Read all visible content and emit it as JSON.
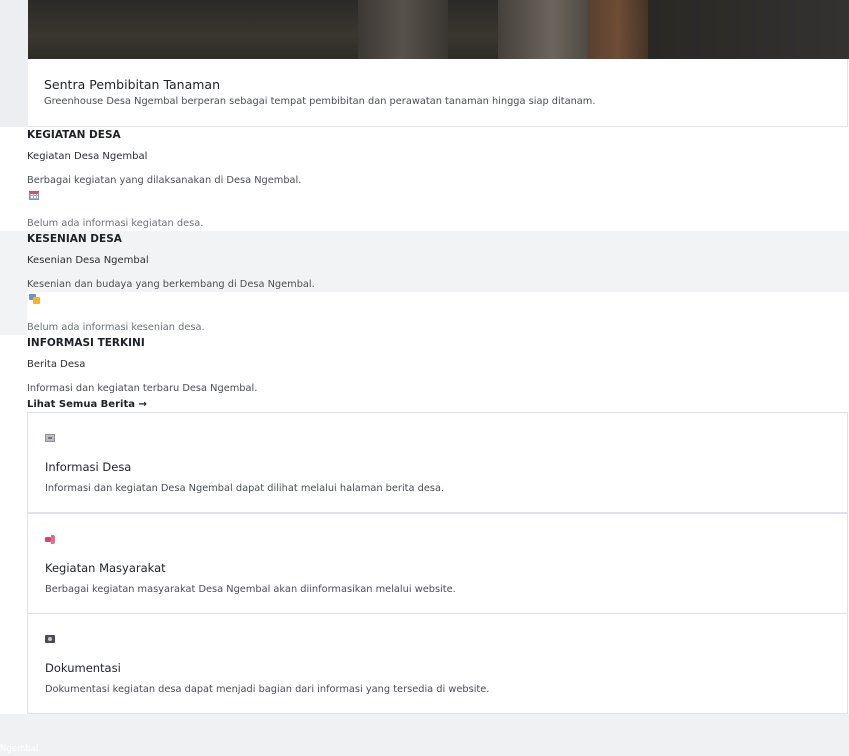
{
  "hero": {
    "title": "Sentra Pembibitan Tanaman",
    "description": "Greenhouse Desa Ngembal berperan sebagai tempat pembibitan dan perawatan tanaman hingga siap ditanam."
  },
  "kegiatan": {
    "label": "KEGIATAN DESA",
    "title": "Kegiatan Desa Ngembal",
    "subtitle": "Berbagai kegiatan yang dilaksanakan di Desa Ngembal.",
    "icon": "calendar-icon",
    "empty_text": "Belum ada informasi kegiatan desa."
  },
  "kesenian": {
    "label": "KESENIAN DESA",
    "title": "Kesenian Desa Ngembal",
    "subtitle": "Kesenian dan budaya yang berkembang di Desa Ngembal.",
    "icon": "art-icon",
    "empty_text": "Belum ada informasi kesenian desa."
  },
  "informasi": {
    "label": "INFORMASI TERKINI",
    "title": "Berita Desa",
    "subtitle": "Informasi dan kegiatan terbaru Desa Ngembal.",
    "link_all": "Lihat Semua Berita →",
    "cards": [
      {
        "icon": "newspaper-icon",
        "title": "Informasi Desa",
        "description": "Informasi dan kegiatan Desa Ngembal dapat dilihat melalui halaman berita desa."
      },
      {
        "icon": "megaphone-icon",
        "title": "Kegiatan Masyarakat",
        "description": "Berbagai kegiatan masyarakat Desa Ngembal akan diinformasikan melalui website."
      },
      {
        "icon": "camera-icon",
        "title": "Dokumentasi",
        "description": "Dokumentasi kegiatan desa dapat menjadi bagian dari informasi yang tersedia di website."
      }
    ]
  },
  "footer": {
    "text": "Ngembal"
  },
  "colors": {
    "background": "#ffffff",
    "section_gray": "#f2f3f5",
    "card_border": "#dfe2e6",
    "text_dark": "#1d2125",
    "text_muted": "#4a4f55"
  }
}
